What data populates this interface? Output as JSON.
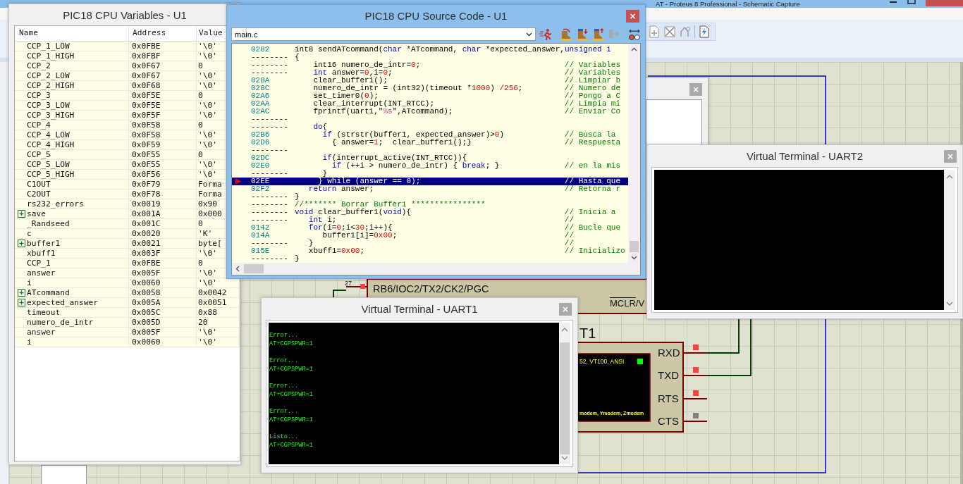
{
  "main_window": {
    "title": "AT - Proteus 8 Professional - Schematic Capture"
  },
  "variables_window": {
    "title": "PIC18 CPU Variables - U1",
    "columns": [
      "Name",
      "Address",
      "Value"
    ],
    "rows": [
      {
        "name": "CCP_1_LOW",
        "address": "0x0FBE",
        "value": "'\\0'",
        "expandable": false
      },
      {
        "name": "CCP_1_HIGH",
        "address": "0x0FBF",
        "value": "'\\0'",
        "expandable": false
      },
      {
        "name": "CCP_2",
        "address": "0x0F67",
        "value": "0",
        "expandable": false
      },
      {
        "name": "CCP_2_LOW",
        "address": "0x0F67",
        "value": "'\\0'",
        "expandable": false
      },
      {
        "name": "CCP_2_HIGH",
        "address": "0x0F68",
        "value": "'\\0'",
        "expandable": false
      },
      {
        "name": "CCP_3",
        "address": "0x0F5E",
        "value": "0",
        "expandable": false
      },
      {
        "name": "CCP_3_LOW",
        "address": "0x0F5E",
        "value": "'\\0'",
        "expandable": false
      },
      {
        "name": "CCP_3_HIGH",
        "address": "0x0F5F",
        "value": "'\\0'",
        "expandable": false
      },
      {
        "name": "CCP_4",
        "address": "0x0F58",
        "value": "0",
        "expandable": false
      },
      {
        "name": "CCP_4_LOW",
        "address": "0x0F58",
        "value": "'\\0'",
        "expandable": false
      },
      {
        "name": "CCP_4_HIGH",
        "address": "0x0F59",
        "value": "'\\0'",
        "expandable": false
      },
      {
        "name": "CCP_5",
        "address": "0x0F55",
        "value": "0",
        "expandable": false
      },
      {
        "name": "CCP_5_LOW",
        "address": "0x0F55",
        "value": "'\\0'",
        "expandable": false
      },
      {
        "name": "CCP_5_HIGH",
        "address": "0x0F56",
        "value": "'\\0'",
        "expandable": false
      },
      {
        "name": "C1OUT",
        "address": "0x0F79",
        "value": "Forma",
        "expandable": false
      },
      {
        "name": "C2OUT",
        "address": "0x0F78",
        "value": "Forma",
        "expandable": false
      },
      {
        "name": "rs232_errors",
        "address": "0x0019",
        "value": "0x90",
        "expandable": false
      },
      {
        "name": "save",
        "address": "0x001A",
        "value": "0x000",
        "expandable": true
      },
      {
        "name": "_Randseed",
        "address": "0x001C",
        "value": "0",
        "expandable": false
      },
      {
        "name": "c",
        "address": "0x0020",
        "value": "'K'",
        "expandable": false
      },
      {
        "name": "buffer1",
        "address": "0x0021",
        "value": "byte[",
        "expandable": true
      },
      {
        "name": "xbuff1",
        "address": "0x003F",
        "value": "'\\0'",
        "expandable": false
      },
      {
        "name": "CCP_1",
        "address": "0x0FBE",
        "value": "0",
        "expandable": false
      },
      {
        "name": "answer",
        "address": "0x005F",
        "value": "'\\0'",
        "expandable": false
      },
      {
        "name": "i",
        "address": "0x0060",
        "value": "'\\0'",
        "expandable": false
      },
      {
        "name": "ATcommand",
        "address": "0x0058",
        "value": "0x0042",
        "expandable": true
      },
      {
        "name": "expected_answer",
        "address": "0x005A",
        "value": "0x0051",
        "expandable": true
      },
      {
        "name": "timeout",
        "address": "0x005C",
        "value": "0x88",
        "expandable": false
      },
      {
        "name": "numero_de_intr",
        "address": "0x005D",
        "value": "20",
        "expandable": false
      },
      {
        "name": "answer",
        "address": "0x005F",
        "value": "'\\0'",
        "expandable": false
      },
      {
        "name": "i",
        "address": "0x0060",
        "value": "'\\0'",
        "expandable": false
      }
    ]
  },
  "source_window": {
    "title": "PIC18 CPU Source Code - U1",
    "close": "×",
    "file": "main.c",
    "lines": [
      {
        "kind": "compiled",
        "address": "0282",
        "selected": false,
        "code": [
          {
            "kind": "plain",
            "text": "int8 sendATcommand("
          },
          {
            "kind": "keyword",
            "text": "char"
          },
          {
            "kind": "plain",
            "text": " *ATcommand, "
          },
          {
            "kind": "keyword",
            "text": "char"
          },
          {
            "kind": "plain",
            "text": " *expected_answer,"
          },
          {
            "kind": "keyword",
            "text": "unsigned i"
          }
        ]
      },
      {
        "kind": "source",
        "address": "--------",
        "selected": false,
        "code": [
          {
            "kind": "plain",
            "text": "{"
          }
        ]
      },
      {
        "kind": "source",
        "address": "--------",
        "selected": false,
        "code": [
          {
            "kind": "plain",
            "text": "    int16 numero_de_intr="
          },
          {
            "kind": "number",
            "text": "0"
          },
          {
            "kind": "plain",
            "text": ";"
          }
        ],
        "comment": "// Variables"
      },
      {
        "kind": "source",
        "address": "--------",
        "selected": false,
        "code": [
          {
            "kind": "keyword",
            "text": "    int"
          },
          {
            "kind": "plain",
            "text": " answer="
          },
          {
            "kind": "number",
            "text": "0"
          },
          {
            "kind": "plain",
            "text": ",i="
          },
          {
            "kind": "number",
            "text": "0"
          },
          {
            "kind": "plain",
            "text": ";"
          }
        ],
        "comment": "// Variables"
      },
      {
        "kind": "compiled",
        "address": "028A",
        "selected": false,
        "code": [
          {
            "kind": "plain",
            "text": "    clear_buffer1();"
          }
        ],
        "comment": "// Limpiar b"
      },
      {
        "kind": "compiled",
        "address": "028C",
        "selected": false,
        "code": [
          {
            "kind": "plain",
            "text": "    numero_de_intr = (int32)(timeout *"
          },
          {
            "kind": "number",
            "text": "1000"
          },
          {
            "kind": "plain",
            "text": ") "
          },
          {
            "kind": "number",
            "text": "/256"
          },
          {
            "kind": "plain",
            "text": ";"
          }
        ],
        "comment": "// Numero de"
      },
      {
        "kind": "compiled",
        "address": "02A6",
        "selected": false,
        "code": [
          {
            "kind": "plain",
            "text": "    set_timer0("
          },
          {
            "kind": "number",
            "text": "0"
          },
          {
            "kind": "plain",
            "text": ");"
          }
        ],
        "comment": "// Pongo a C"
      },
      {
        "kind": "compiled",
        "address": "02AA",
        "selected": false,
        "code": [
          {
            "kind": "plain",
            "text": "    clear_interrupt(INT_RTCC);"
          }
        ],
        "comment": "// Limpia mi"
      },
      {
        "kind": "compiled",
        "address": "02AC",
        "selected": false,
        "code": [
          {
            "kind": "plain",
            "text": "    fprintf(uart1,\""
          },
          {
            "kind": "string",
            "text": "%s"
          },
          {
            "kind": "plain",
            "text": "\",ATcommand);"
          }
        ],
        "comment": "// Enviar Co"
      },
      {
        "kind": "source",
        "address": "--------",
        "selected": false
      },
      {
        "kind": "source",
        "address": "--------",
        "selected": false,
        "code": [
          {
            "kind": "keyword",
            "text": "    do"
          },
          {
            "kind": "plain",
            "text": "{"
          }
        ]
      },
      {
        "kind": "compiled",
        "address": "02B6",
        "selected": false,
        "code": [
          {
            "kind": "keyword",
            "text": "      if"
          },
          {
            "kind": "plain",
            "text": " (strstr(buffer1, expected_answer)>"
          },
          {
            "kind": "number",
            "text": "0"
          },
          {
            "kind": "plain",
            "text": ")"
          }
        ],
        "comment": "// Busca la"
      },
      {
        "kind": "compiled",
        "address": "02D6",
        "selected": false,
        "code": [
          {
            "kind": "plain",
            "text": "        { answer="
          },
          {
            "kind": "number",
            "text": "1"
          },
          {
            "kind": "plain",
            "text": ";  clear_buffer1();}"
          }
        ],
        "comment": "// Respuesta"
      },
      {
        "kind": "source",
        "address": "--------",
        "selected": false
      },
      {
        "kind": "compiled",
        "address": "02DC",
        "selected": false,
        "code": [
          {
            "kind": "keyword",
            "text": "      if"
          },
          {
            "kind": "plain",
            "text": "(interrupt_active(INT_RTCC)){"
          }
        ]
      },
      {
        "kind": "compiled",
        "address": "02E0",
        "selected": false,
        "code": [
          {
            "kind": "keyword",
            "text": "        if"
          },
          {
            "kind": "plain",
            "text": " (++i > numero_de_intr) { "
          },
          {
            "kind": "keyword",
            "text": "break"
          },
          {
            "kind": "plain",
            "text": "; }"
          }
        ],
        "comment": "// en la mis"
      },
      {
        "kind": "source",
        "address": "--------",
        "selected": false,
        "code": [
          {
            "kind": "plain",
            "text": "      }"
          }
        ]
      },
      {
        "kind": "compiled",
        "address": "02EE",
        "selected": true,
        "code": [
          {
            "kind": "plain",
            "text": "     } "
          },
          {
            "kind": "keyword",
            "text": "while"
          },
          {
            "kind": "plain",
            "text": " (answer == "
          },
          {
            "kind": "number",
            "text": "0"
          },
          {
            "kind": "plain",
            "text": ");"
          }
        ],
        "comment": "// Hasta que"
      },
      {
        "kind": "compiled",
        "address": "02F2",
        "selected": false,
        "code": [
          {
            "kind": "keyword",
            "text": "   return"
          },
          {
            "kind": "plain",
            "text": " answer;"
          }
        ],
        "comment": "// Retorna r"
      },
      {
        "kind": "source",
        "address": "--------",
        "selected": false,
        "code": [
          {
            "kind": "plain",
            "text": "}"
          }
        ]
      },
      {
        "kind": "source",
        "address": "--------",
        "selected": false,
        "code": [
          {
            "kind": "comment",
            "text": "//******* Borrar Buffer1 ****************"
          }
        ]
      },
      {
        "kind": "source",
        "address": "--------",
        "selected": false,
        "code": [
          {
            "kind": "keyword",
            "text": "void"
          },
          {
            "kind": "plain",
            "text": " clear_buffer1("
          },
          {
            "kind": "keyword",
            "text": "void"
          },
          {
            "kind": "plain",
            "text": "){"
          }
        ],
        "comment": "// Inicia a"
      },
      {
        "kind": "source",
        "address": "--------",
        "selected": false,
        "code": [
          {
            "kind": "keyword",
            "text": "   int"
          },
          {
            "kind": "plain",
            "text": " i;"
          }
        ],
        "comment": "//"
      },
      {
        "kind": "compiled",
        "address": "0142",
        "selected": false,
        "code": [
          {
            "kind": "keyword",
            "text": "   for"
          },
          {
            "kind": "plain",
            "text": "(i="
          },
          {
            "kind": "number",
            "text": "0"
          },
          {
            "kind": "plain",
            "text": ";i<"
          },
          {
            "kind": "number",
            "text": "30"
          },
          {
            "kind": "plain",
            "text": ";i++){"
          }
        ],
        "comment": "// Bucle que"
      },
      {
        "kind": "compiled",
        "address": "014A",
        "selected": false,
        "code": [
          {
            "kind": "plain",
            "text": "      buffer1[i]="
          },
          {
            "kind": "number",
            "text": "0x00"
          },
          {
            "kind": "plain",
            "text": ";"
          }
        ],
        "comment": "//"
      },
      {
        "kind": "source",
        "address": "--------",
        "selected": false,
        "code": [
          {
            "kind": "plain",
            "text": "   }"
          }
        ],
        "comment": "//"
      },
      {
        "kind": "compiled",
        "address": "015E",
        "selected": false,
        "code": [
          {
            "kind": "plain",
            "text": "   xbuff1="
          },
          {
            "kind": "number",
            "text": "0x00"
          },
          {
            "kind": "plain",
            "text": ";"
          }
        ],
        "comment": "// Inicializo"
      },
      {
        "kind": "source",
        "address": "--------",
        "selected": false,
        "code": [
          {
            "kind": "plain",
            "text": "}"
          }
        ]
      }
    ]
  },
  "small_window": {
    "close": "×"
  },
  "terminals": [
    {
      "title": "Virtual Terminal - UART1",
      "close": "×",
      "messages": [
        {
          "status": "Error...",
          "command": "AT+CGPSPWR=1"
        },
        {
          "status": "Error...",
          "command": "AT+CGPSPWR=1"
        },
        {
          "status": "Error...",
          "command": "AT+CGPSPWR=1"
        },
        {
          "status": "Error...",
          "command": "AT+CGPSPWR=1"
        },
        {
          "status": "Listo...",
          "command": "AT+CGPSPWR=1"
        }
      ]
    },
    {
      "title": "Virtual Terminal - UART2",
      "close": "×"
    }
  ],
  "schematic": {
    "pin_number": "27",
    "pin_label": "RB6/IOC2/TX2/CK2/PGC",
    "reset_pin": {
      "overlined": "MCLR",
      "rest": "/V"
    },
    "terminal_part": {
      "name": "T1",
      "screen_lines": [
        "52, VT100, ANSI",
        "modem, Ymodem, Zmodem"
      ],
      "pins": [
        {
          "name": "RXD",
          "color": "#ff4040"
        },
        {
          "name": "TXD",
          "color": "#ff4040"
        },
        {
          "name": "RTS",
          "color": "#ff4040"
        },
        {
          "name": "CTS",
          "color": "#808080"
        }
      ]
    }
  }
}
